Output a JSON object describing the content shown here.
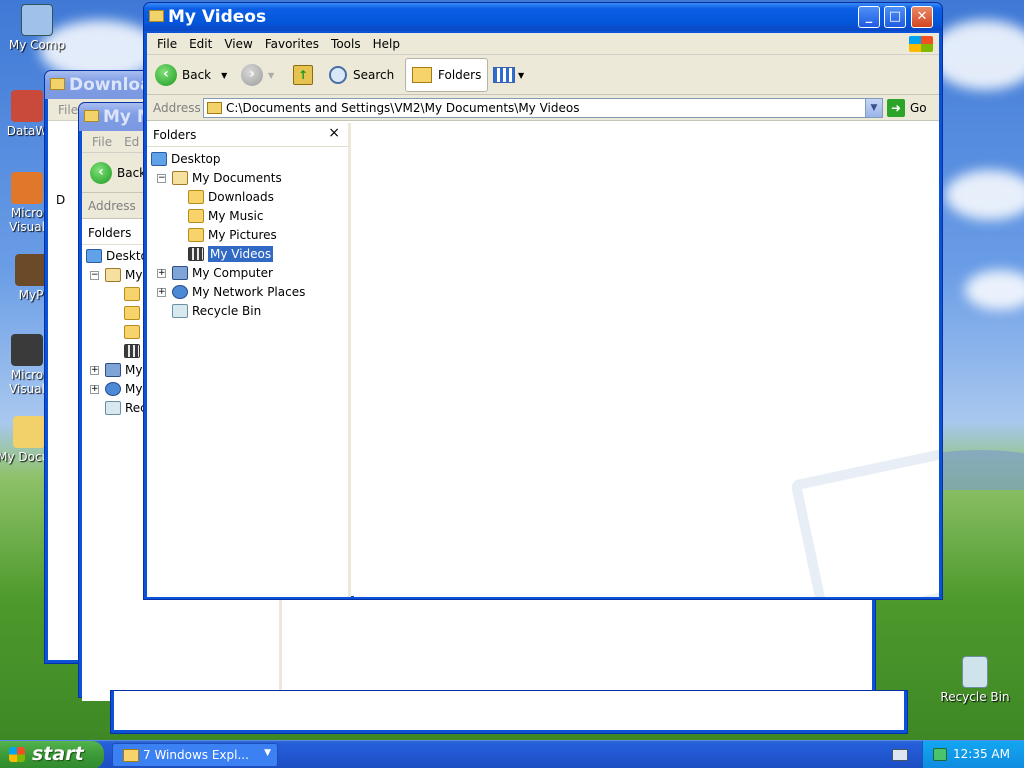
{
  "desktop": {
    "icons": [
      {
        "label": "My Computer",
        "short": "My Comp"
      },
      {
        "label": "DataW",
        "short": "DataW"
      },
      {
        "label": "Microsoft Visual",
        "short": "Micro Visual"
      },
      {
        "label": "MyP",
        "short": "MyP"
      },
      {
        "label": "Microsoft Visual",
        "short": "Micro Visual"
      },
      {
        "label": "My Documents",
        "short": "My Docum"
      },
      {
        "label": "Recycle Bin",
        "short": "Recycle Bin"
      }
    ]
  },
  "back_window_1": {
    "title": "Downloa",
    "menu": [
      "File"
    ],
    "tree_labels": [
      "D"
    ]
  },
  "back_window_2": {
    "title": "My M",
    "menu": [
      "File",
      "Ed"
    ],
    "back_label": "Back",
    "address_label": "Address",
    "folders_label": "Folders",
    "tree": [
      "Deskto",
      "My",
      "My",
      "My",
      "Rec"
    ]
  },
  "main_window": {
    "title": "My Videos",
    "menu": [
      "File",
      "Edit",
      "View",
      "Favorites",
      "Tools",
      "Help"
    ],
    "toolbar": {
      "back": "Back",
      "search": "Search",
      "folders": "Folders"
    },
    "address": {
      "label": "Address",
      "path": "C:\\Documents and Settings\\VM2\\My Documents\\My Videos",
      "go": "Go"
    },
    "folders_pane": {
      "header": "Folders",
      "close": "×",
      "tree": [
        {
          "label": "Desktop",
          "level": 0,
          "icon": "desktop-icon",
          "expander": ""
        },
        {
          "label": "My Documents",
          "level": 1,
          "icon": "documents-folder-icon",
          "expander": "−"
        },
        {
          "label": "Downloads",
          "level": 2,
          "icon": "folder-icon",
          "expander": ""
        },
        {
          "label": "My Music",
          "level": 2,
          "icon": "music-folder-icon",
          "expander": ""
        },
        {
          "label": "My Pictures",
          "level": 2,
          "icon": "pictures-folder-icon",
          "expander": ""
        },
        {
          "label": "My Videos",
          "level": 2,
          "icon": "videos-folder-icon",
          "expander": "",
          "selected": true
        },
        {
          "label": "My Computer",
          "level": 1,
          "icon": "computer-icon",
          "expander": "+"
        },
        {
          "label": "My Network Places",
          "level": 1,
          "icon": "network-icon",
          "expander": "+"
        },
        {
          "label": "Recycle Bin",
          "level": 1,
          "icon": "recycle-bin-icon",
          "expander": ""
        }
      ]
    }
  },
  "taskbar": {
    "start": "start",
    "task_button": "7 Windows Expl...",
    "clock": "12:35 AM"
  }
}
